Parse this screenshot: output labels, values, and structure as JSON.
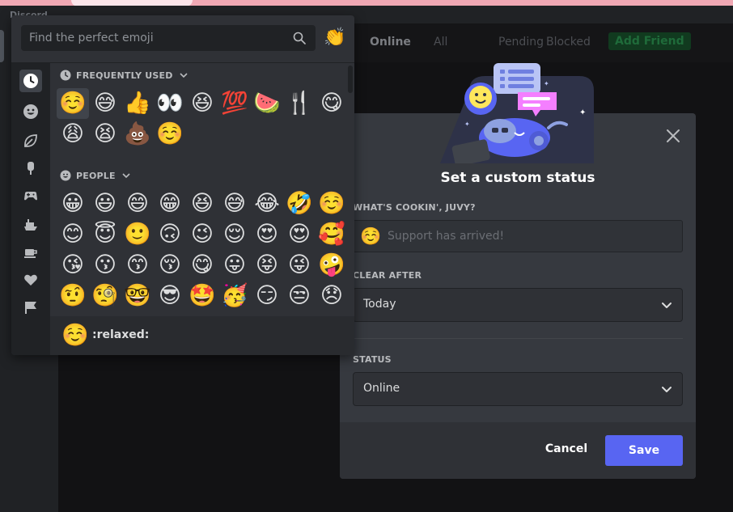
{
  "app": {
    "title": "Discord"
  },
  "friends_header": {
    "tabs": [
      "Online",
      "All",
      "Pending",
      "Blocked"
    ],
    "add_friend": "Add Friend"
  },
  "emoji_picker": {
    "search_placeholder": "Find the perfect emoji",
    "skin_tone_emoji": "👏",
    "categories": [
      "recent",
      "people",
      "nature",
      "food",
      "activities",
      "travel",
      "objects",
      "symbols",
      "flags"
    ],
    "frequently_used": {
      "title": "FREQUENTLY USED",
      "emojis": [
        "☺️",
        "😅",
        "👍",
        "👀",
        "😆",
        "💯",
        "🍉",
        "🍴",
        "😋",
        "😩",
        "😫",
        "💩",
        "☺️"
      ]
    },
    "people": {
      "title": "PEOPLE",
      "emojis": [
        "😀",
        "😃",
        "😄",
        "😁",
        "😆",
        "😅",
        "😂",
        "🤣",
        "☺️",
        "😊",
        "😇",
        "🙂",
        "🙃",
        "😉",
        "😌",
        "😍",
        "😍",
        "🥰",
        "😘",
        "😗",
        "😙",
        "😚",
        "😋",
        "😛",
        "😝",
        "😜",
        "🤪",
        "🤨",
        "🧐",
        "🤓",
        "😎",
        "🤩",
        "🥳",
        "😏",
        "😒",
        "😞"
      ]
    },
    "footer": {
      "emoji": "☺️",
      "name": ":relaxed:"
    }
  },
  "custom_status": {
    "title": "Set a custom status",
    "prompt_label": "WHAT'S COOKIN', JUVY?",
    "status_emoji": "☺️",
    "input_placeholder": "Support has arrived!",
    "clear_after_label": "CLEAR AFTER",
    "clear_after_value": "Today",
    "status_label": "STATUS",
    "status_value": "Online",
    "cancel_label": "Cancel",
    "save_label": "Save"
  },
  "colors": {
    "accent": "#5865f2",
    "modal_bg": "#36393f",
    "picker_bg": "#2f3136",
    "rail_bg": "#202225"
  }
}
